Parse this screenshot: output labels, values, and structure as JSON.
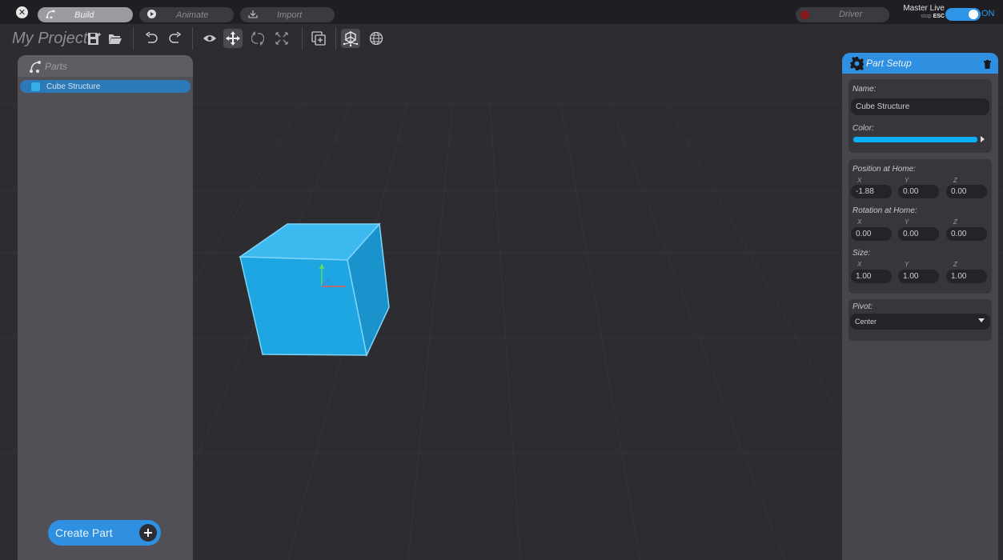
{
  "topbar": {
    "close_glyph": "✕",
    "tabs": [
      {
        "label": "Build",
        "icon": "parts-tree-icon",
        "active": true
      },
      {
        "label": "Animate",
        "icon": "play-icon",
        "active": false
      },
      {
        "label": "Import",
        "icon": "import-icon",
        "active": false
      }
    ],
    "driver_label": "Driver",
    "master_live_label": "Master Live",
    "stop_label": "stop",
    "esc_label": "ESC",
    "toggle_label": "ON"
  },
  "toolbar": {
    "project_title": "My Project"
  },
  "parts_panel": {
    "title": "Parts",
    "items": [
      {
        "label": "Cube Structure",
        "selected": true
      }
    ],
    "create_button_label": "Create Part",
    "plus_glyph": "+"
  },
  "setup_panel": {
    "title": "Part Setup",
    "name_label": "Name:",
    "name_value": "Cube Structure",
    "color_label": "Color:",
    "color_value": "#0aaef4",
    "position_label": "Position at Home:",
    "rotation_label": "Rotation at Home:",
    "size_label": "Size:",
    "axes": [
      "X",
      "Y",
      "Z"
    ],
    "position": [
      "-1.88",
      "0.00",
      "0.00"
    ],
    "rotation": [
      "0.00",
      "0.00",
      "0.00"
    ],
    "size": [
      "1.00",
      "1.00",
      "1.00"
    ],
    "pivot_label": "Pivot:",
    "pivot_value": "Center"
  },
  "colors": {
    "accent": "#2f8fe0",
    "cube": "#1ea6e2",
    "panel": "#505056",
    "background": "#2c2c31"
  }
}
